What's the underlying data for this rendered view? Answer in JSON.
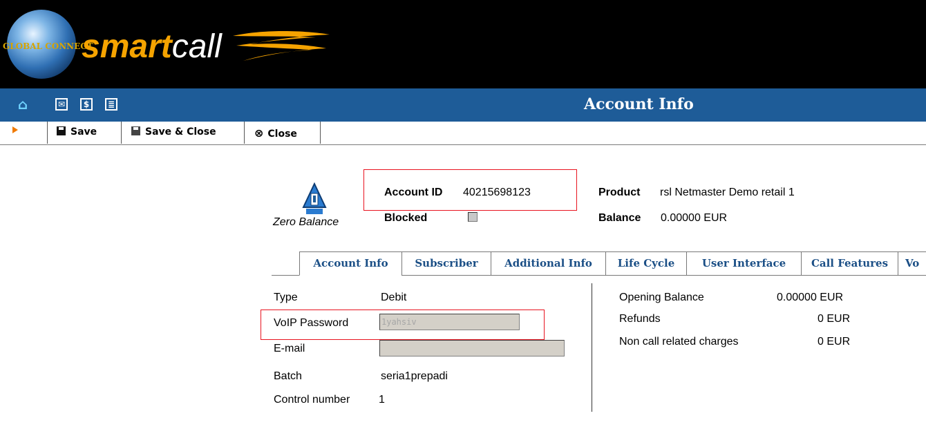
{
  "app": {
    "brand": "smartcall",
    "brand_sub": "GLOBAL CONNECT"
  },
  "nav_icons": [
    "home-icon",
    "mail-icon",
    "billing-icon",
    "list-icon"
  ],
  "page_title": "Account Info",
  "toolbar": {
    "save_label": "Save",
    "save_close_label": "Save & Close",
    "close_label": "Close"
  },
  "account": {
    "status_label": "Zero Balance",
    "account_id_label": "Account ID",
    "account_id": "40215698123",
    "blocked_label": "Blocked",
    "blocked": false,
    "product_label": "Product",
    "product": "rsl Netmaster Demo retail 1",
    "balance_label": "Balance",
    "balance": "0.00000 EUR"
  },
  "tabs": [
    {
      "label": "Account Info",
      "active": true
    },
    {
      "label": "Subscriber"
    },
    {
      "label": "Additional Info"
    },
    {
      "label": "Life Cycle"
    },
    {
      "label": "User Interface"
    },
    {
      "label": "Call Features"
    },
    {
      "label": "Vo"
    }
  ],
  "details": {
    "type_label": "Type",
    "type": "Debit",
    "voip_password_label": "VoIP Password",
    "voip_password": "1yahsiv",
    "email_label": "E-mail",
    "email": "",
    "batch_label": "Batch",
    "batch": "seria1prepadi",
    "control_number_label": "Control number",
    "control_number": "1"
  },
  "financials": {
    "opening_balance_label": "Opening Balance",
    "opening_balance": "0.00000 EUR",
    "refunds_label": "Refunds",
    "refunds": "0 EUR",
    "non_call_label": "Non call related charges",
    "non_call": "0 EUR"
  },
  "colors": {
    "header_bg": "#000000",
    "titlebar_bg": "#1e5c98",
    "brand_orange": "#f5a300",
    "tab_text": "#1b4f86",
    "highlight_red": "#e8121e"
  }
}
